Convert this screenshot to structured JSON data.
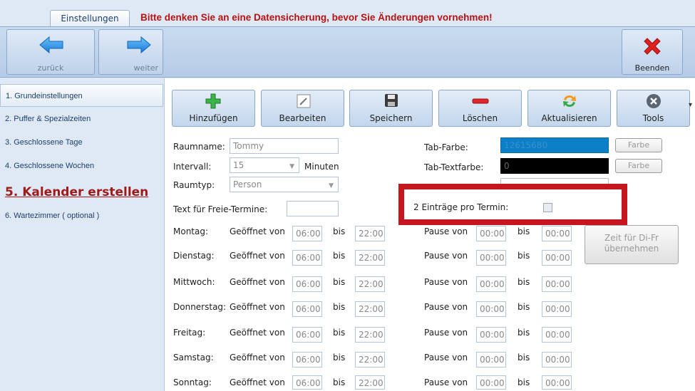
{
  "top": {
    "tab_label": "Einstellungen",
    "warning": "Bitte denken Sie an eine Datensicherung, bevor Sie Änderungen vornehmen!"
  },
  "nav": {
    "back_label": "zurück",
    "forward_label": "weiter",
    "exit_label": "Beenden"
  },
  "sidebar": {
    "items": [
      {
        "label": "1. Grundeinstellungen"
      },
      {
        "label": "2. Puffer & Spezialzeiten"
      },
      {
        "label": "3. Geschlossene Tage"
      },
      {
        "label": "4. Geschlossene Wochen"
      },
      {
        "label": "5. Kalender erstellen"
      },
      {
        "label": "6. Wartezimmer ( optional )"
      }
    ]
  },
  "toolbar": {
    "add": "Hinzufügen",
    "edit": "Bearbeiten",
    "save": "Speichern",
    "delete": "Löschen",
    "refresh": "Aktualisieren",
    "tools": "Tools"
  },
  "form": {
    "room_name_label": "Raumname:",
    "room_name_value": "Tommy",
    "interval_label": "Intervall:",
    "interval_value": "15",
    "interval_unit": "Minuten",
    "room_type_label": "Raumtyp:",
    "room_type_value": "Person",
    "free_text_label": "Text für Freie-Termine:",
    "free_text_value": "",
    "tab_color_label": "Tab-Farbe:",
    "tab_color_value": "12615680",
    "tab_textcolor_label": "Tab-Textfarbe:",
    "tab_textcolor_value": "0",
    "color_button": "Farbe",
    "two_entries_label": "2 Einträge pro Termin:",
    "copy_button": "Zeit für Di-Fr übernehmen"
  },
  "days": {
    "open_label": "Geöffnet von",
    "to_label": "bis",
    "pause_label": "Pause von",
    "rows": [
      {
        "day": "Montag:",
        "open_from": "06:00",
        "open_to": "22:00",
        "pause_from": "00:00",
        "pause_to": "00:00"
      },
      {
        "day": "Dienstag:",
        "open_from": "06:00",
        "open_to": "22:00",
        "pause_from": "00:00",
        "pause_to": "00:00"
      },
      {
        "day": "Mittwoch:",
        "open_from": "06:00",
        "open_to": "22:00",
        "pause_from": "00:00",
        "pause_to": "00:00"
      },
      {
        "day": "Donnerstag:",
        "open_from": "06:00",
        "open_to": "22:00",
        "pause_from": "00:00",
        "pause_to": "00:00"
      },
      {
        "day": "Freitag:",
        "open_from": "06:00",
        "open_to": "22:00",
        "pause_from": "00:00",
        "pause_to": "00:00"
      },
      {
        "day": "Samstag:",
        "open_from": "06:00",
        "open_to": "22:00",
        "pause_from": "00:00",
        "pause_to": "00:00"
      },
      {
        "day": "Sonntag:",
        "open_from": "06:00",
        "open_to": "22:00",
        "pause_from": "00:00",
        "pause_to": "00:00"
      }
    ]
  },
  "colors": {
    "warning": "#b81212",
    "highlight": "#c4161c",
    "tab_color_swatch": "#0b7fc7",
    "tab_textcolor_swatch": "#000000"
  }
}
